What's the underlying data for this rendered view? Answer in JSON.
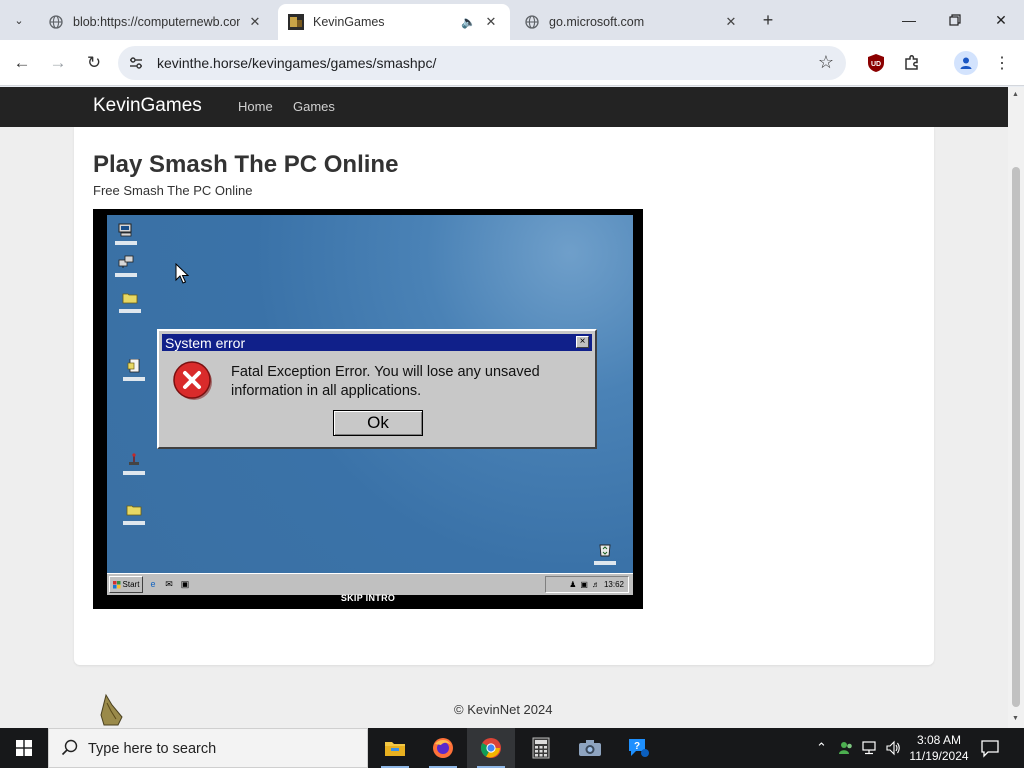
{
  "browser": {
    "tabs": [
      {
        "title": "blob:https://computernewb.com",
        "active": false,
        "favicon": "globe-icon"
      },
      {
        "title": "KevinGames",
        "active": true,
        "favicon": "kevingames-icon",
        "audio": true
      },
      {
        "title": "go.microsoft.com",
        "active": false,
        "favicon": "globe-icon"
      }
    ],
    "url": "kevinthe.horse/kevingames/games/smashpc/"
  },
  "site": {
    "brand": "KevinGames",
    "nav": [
      "Home",
      "Games"
    ],
    "title": "Play Smash The PC Online",
    "subtitle": "Free Smash The PC Online",
    "footer": "© KevinNet 2024"
  },
  "game": {
    "dialog": {
      "title": "System error",
      "close": "×",
      "message": "Fatal Exception Error. You will lose any unsaved information in all applications.",
      "ok_label": "Ok"
    },
    "start_label": "Start",
    "clock": "13:62",
    "skip_label": "SKIP INTRO"
  },
  "taskbar": {
    "search_placeholder": "Type here to search",
    "apps": [
      "file-explorer-icon",
      "firefox-icon",
      "chrome-icon",
      "calculator-icon",
      "camera-icon",
      "help-icon"
    ],
    "time": "3:08 AM",
    "date": "11/19/2024"
  },
  "colors": {
    "site_nav": "#232323",
    "dialog_title": "#10208a",
    "desktop_blue": "#3a72a8"
  }
}
